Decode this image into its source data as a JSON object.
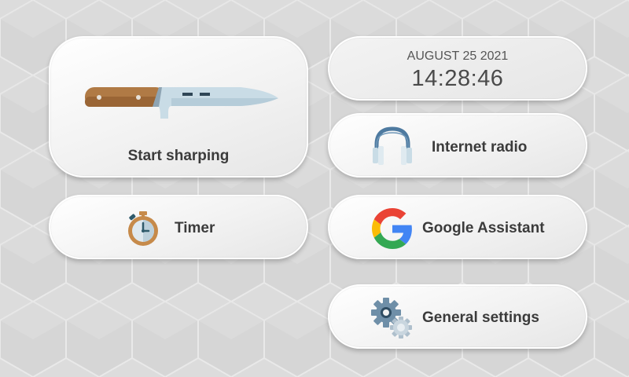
{
  "clock": {
    "date": "AUGUST 25 2021",
    "time": "14:28:46"
  },
  "buttons": {
    "start_sharpening": {
      "label": "Start sharping",
      "icon": "knife-icon"
    },
    "timer": {
      "label": "Timer",
      "icon": "stopwatch-icon"
    },
    "internet_radio": {
      "label": "Internet radio",
      "icon": "headphones-icon"
    },
    "google_assistant": {
      "label": "Google Assistant",
      "icon": "google-icon"
    },
    "general_settings": {
      "label": "General settings",
      "icon": "gears-icon"
    }
  },
  "colors": {
    "background": "#dcdcdc",
    "card": "#f4f4f4",
    "text": "#3b3b3b",
    "knife_handle": "#b07a45",
    "knife_blade": "#c9dce6",
    "headphones": "#4e7aa0",
    "google_blue": "#4285F4",
    "google_red": "#EA4335",
    "google_yellow": "#FBBC05",
    "google_green": "#34A853"
  }
}
